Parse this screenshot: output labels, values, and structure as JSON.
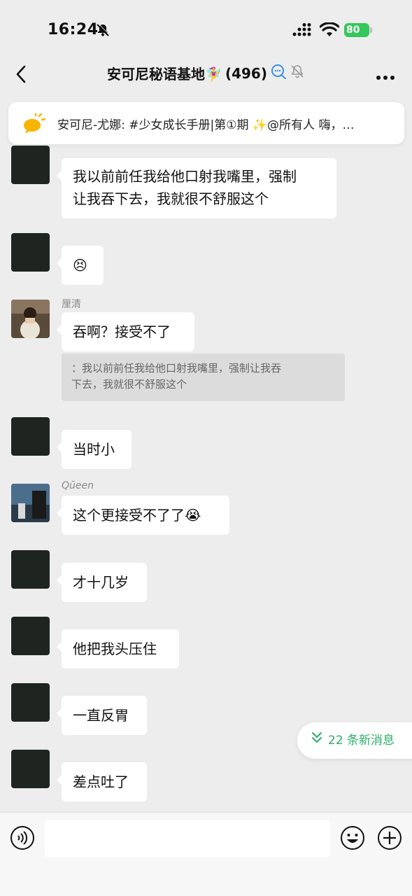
{
  "status_bar": {
    "time": "16:24",
    "battery": "80"
  },
  "nav": {
    "title": "安可尼秘语基地🧚‍♀️",
    "count": "(496)"
  },
  "pinned": {
    "text": "安可尼-尤娜: #少女成长手册|第①期 ✨@所有人  嗨，…"
  },
  "messages": [
    {
      "text_line1": "我以前前任我给他口射我嘴里，强制",
      "text_line2": "让我吞下去，我就很不舒服这个"
    },
    {
      "text": "😣"
    },
    {
      "sender": "厘清",
      "text": "吞啊？接受不了",
      "quote_line1": "：我以前前任我给他口射我嘴里，强制让我吞",
      "quote_line2": "下去，我就很不舒服这个"
    },
    {
      "text": "当时小"
    },
    {
      "sender": "Qūeen",
      "text": "这个更接受不了了😭"
    },
    {
      "text": "才十几岁"
    },
    {
      "text": "他把我头压住"
    },
    {
      "text": "一直反胃"
    },
    {
      "text": "差点吐了"
    }
  ],
  "new_messages": {
    "label": "22 条新消息"
  },
  "colors": {
    "accent_green": "#2bae67",
    "battery_green": "#34c759",
    "background": "#ededed"
  },
  "icons": [
    "back-arrow-icon",
    "muted-bell-icon",
    "more-icon",
    "announcement-icon",
    "voice-icon",
    "emoji-icon",
    "plus-icon"
  ]
}
